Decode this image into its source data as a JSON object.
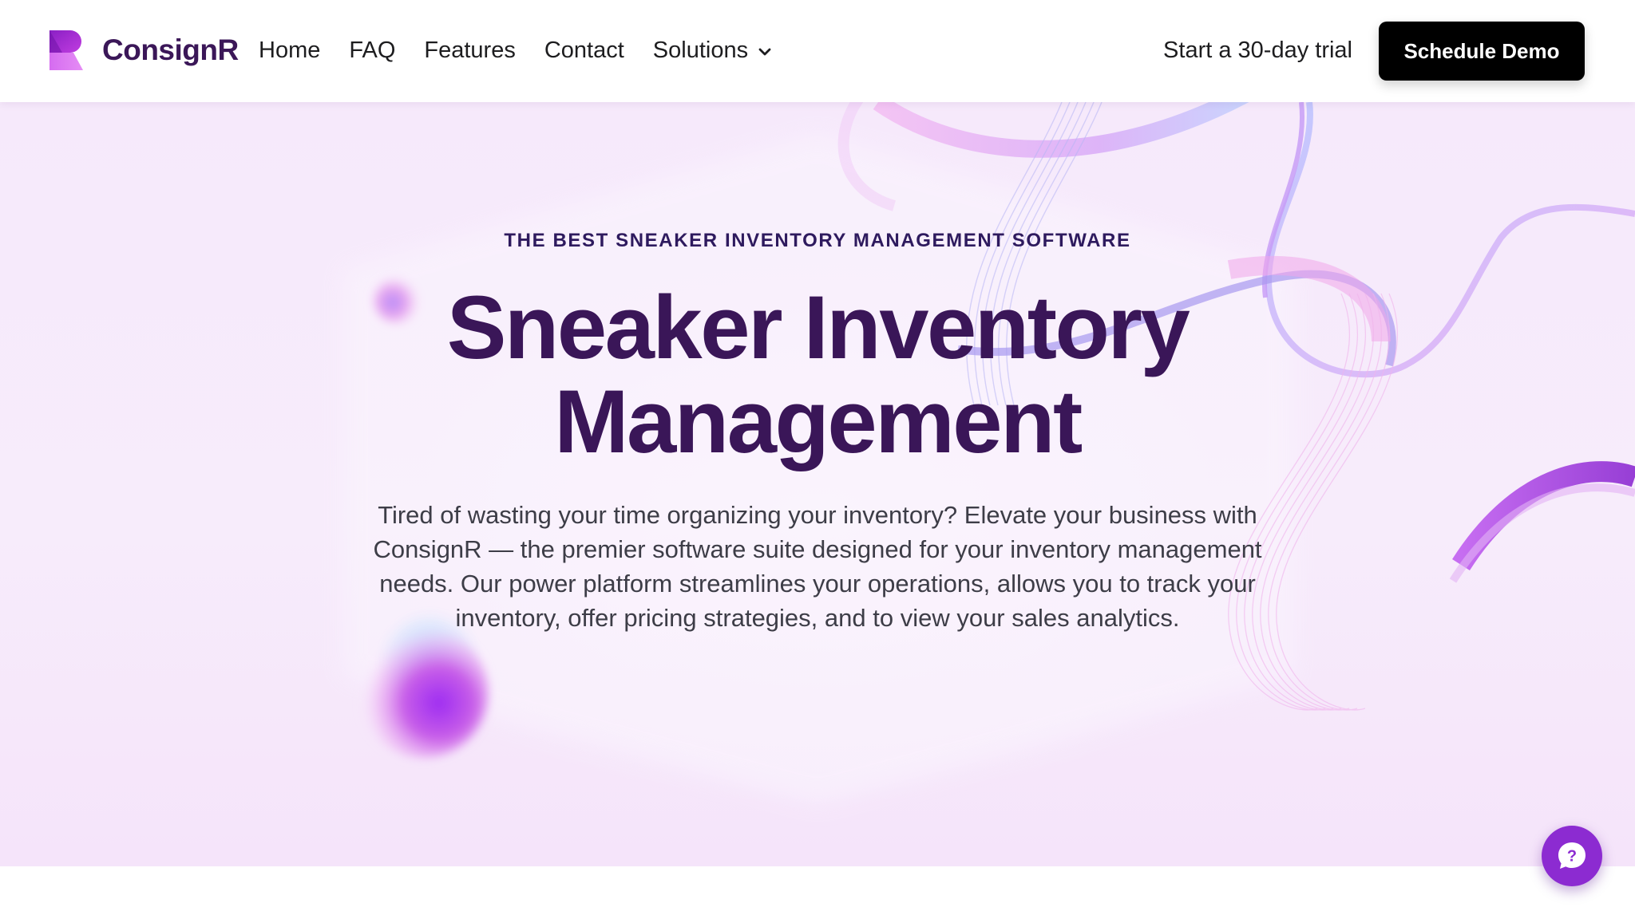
{
  "brand": {
    "name": "ConsignR",
    "primary_color": "#3b1758",
    "accent_color": "#8c2bd1",
    "logo_icon": "consignr-logo-icon"
  },
  "nav": {
    "links": [
      {
        "label": "Home"
      },
      {
        "label": "FAQ"
      },
      {
        "label": "Features"
      },
      {
        "label": "Contact"
      },
      {
        "label": "Solutions",
        "icon": "chevron-down-icon"
      }
    ],
    "trial_label": "Start a 30-day trial",
    "demo_label": "Schedule Demo"
  },
  "hero": {
    "eyebrow": "THE BEST SNEAKER INVENTORY MANAGEMENT SOFTWARE",
    "headline_line1": "Sneaker Inventory",
    "headline_line2": "Management",
    "description": "Tired of wasting your time organizing your inventory? Elevate your business with ConsignR — the premier software suite designed for your inventory management needs. Our power platform streamlines your operations, allows you to track your inventory, offer pricing strategies, and to view your sales analytics."
  },
  "help_widget": {
    "icon": "question-chat-icon",
    "color": "#8c2bd1"
  }
}
